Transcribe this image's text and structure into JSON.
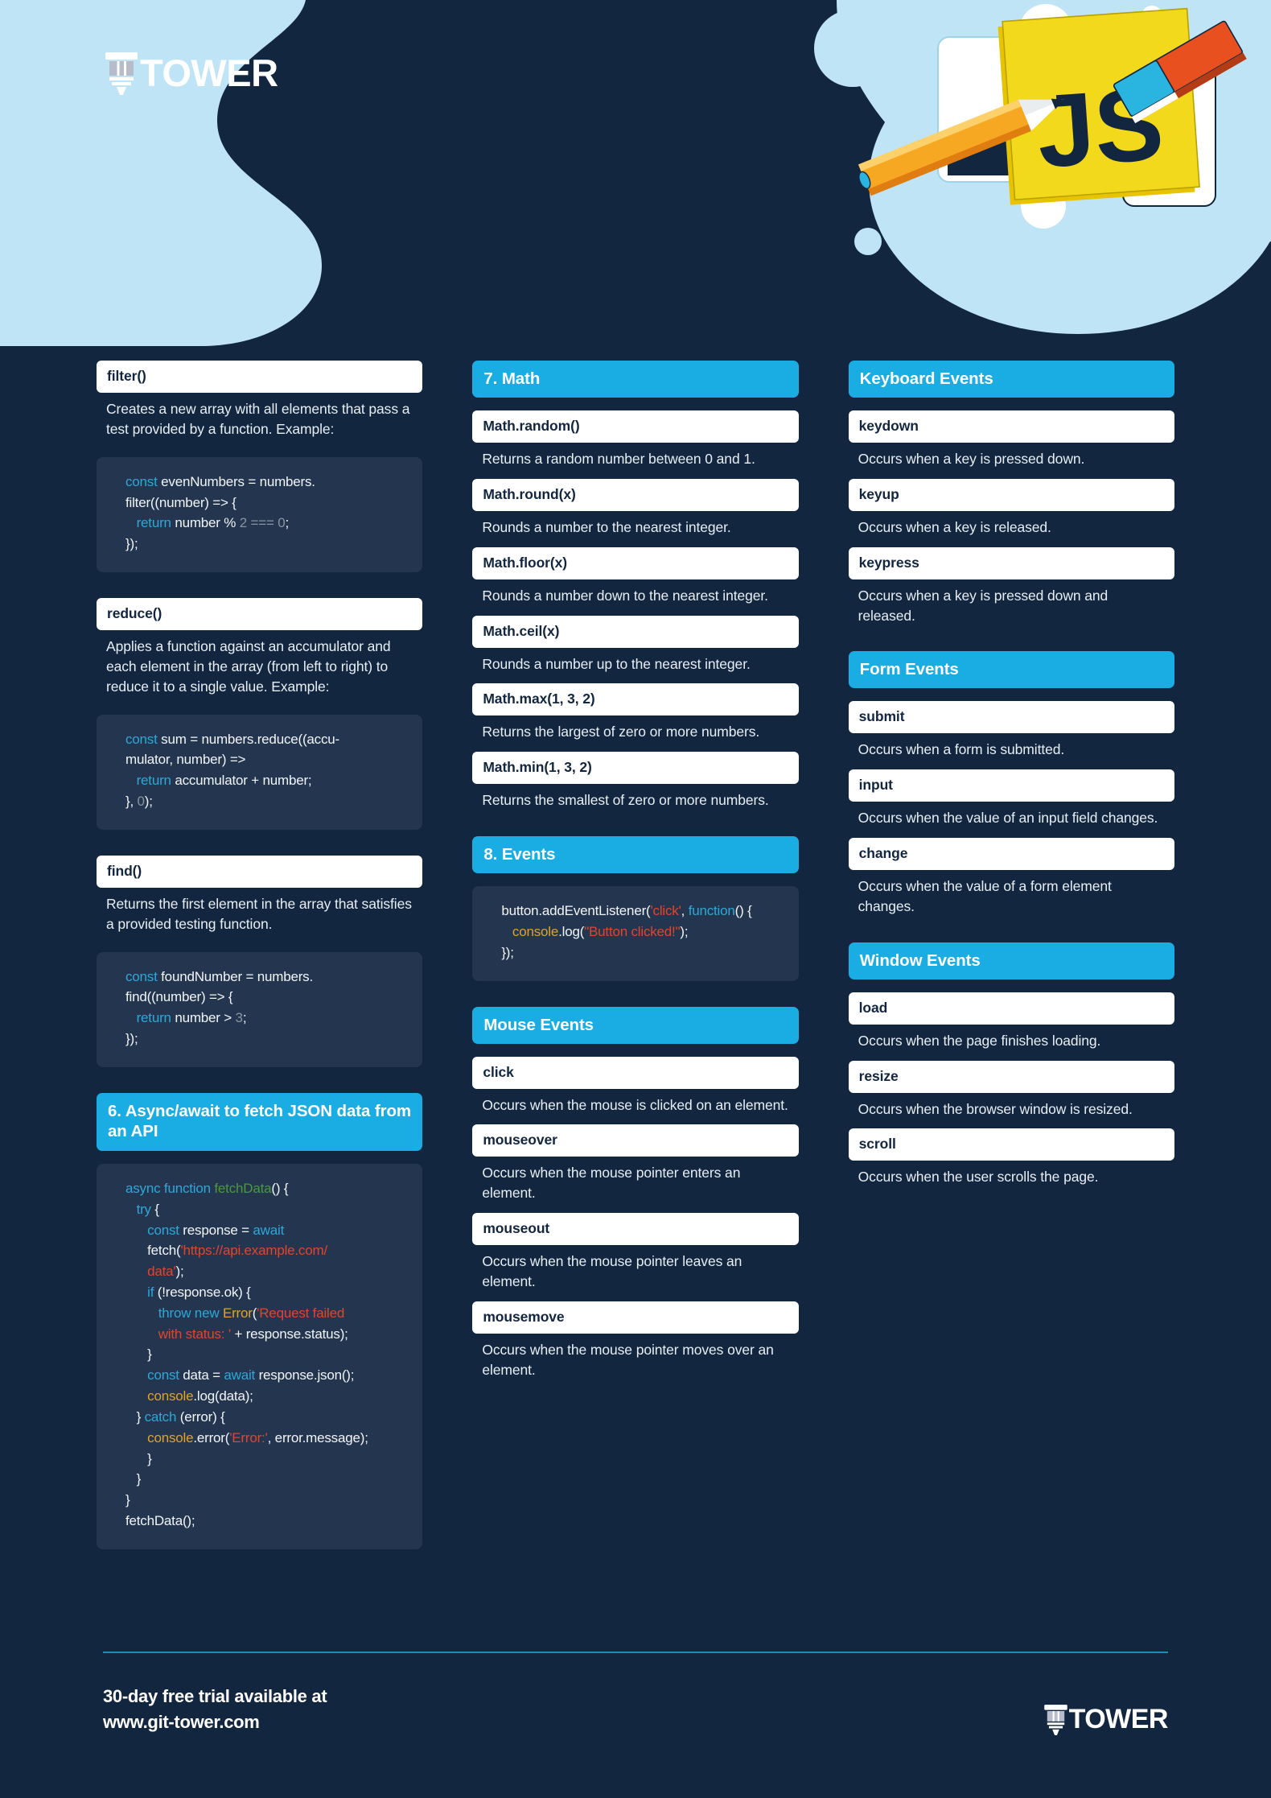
{
  "brand": {
    "name": "TOWER",
    "logo_icon": "tower-logo-icon",
    "js_badge": "JS"
  },
  "footer": {
    "line1": "30-day free trial available at",
    "line2": "www.git-tower.com",
    "name": "TOWER"
  },
  "colors": {
    "background": "#12263f",
    "accent": "#19ade3",
    "card": "#ffffff",
    "code_bg": "#24354f",
    "js_yellow": "#f2d91c",
    "pale_blue": "#bfe4f5"
  },
  "col1": {
    "filter": {
      "term": "filter()",
      "desc": "Creates a new array with all elements that pass a test provided by a function. Example:",
      "code": [
        {
          "t": "const",
          "c": "kw"
        },
        {
          "t": " evenNumbers = numbers.\nfilter((number) => {\n   ",
          "c": "pl"
        },
        {
          "t": "return",
          "c": "kw"
        },
        {
          "t": " number % ",
          "c": "pl"
        },
        {
          "t": "2",
          "c": "num"
        },
        {
          "t": " === ",
          "c": "num"
        },
        {
          "t": "0",
          "c": "num"
        },
        {
          "t": ";\n});",
          "c": "pl"
        }
      ]
    },
    "reduce": {
      "term": "reduce()",
      "desc": "Applies a function against an accumulator and each element in the array (from left to right) to reduce it to a single value. Example:",
      "code": [
        {
          "t": "const",
          "c": "kw"
        },
        {
          "t": " sum = numbers.reduce((accu-\nmulator, number) =>\n   ",
          "c": "pl"
        },
        {
          "t": "return",
          "c": "kw"
        },
        {
          "t": " accumulator + number;\n}, ",
          "c": "pl"
        },
        {
          "t": "0",
          "c": "num"
        },
        {
          "t": ");",
          "c": "pl"
        }
      ]
    },
    "find": {
      "term": "find()",
      "desc": "Returns the first element in the array that satisfies a provided testing function.",
      "code": [
        {
          "t": "const",
          "c": "kw"
        },
        {
          "t": " foundNumber = numbers.\nfind((number) => {\n   ",
          "c": "pl"
        },
        {
          "t": "return",
          "c": "kw"
        },
        {
          "t": " number > ",
          "c": "pl"
        },
        {
          "t": "3",
          "c": "num"
        },
        {
          "t": ";\n});",
          "c": "pl"
        }
      ]
    },
    "async_section": {
      "heading": "6. Async/await to fetch JSON data from an API",
      "code": [
        {
          "t": "async function",
          "c": "kw"
        },
        {
          "t": " ",
          "c": "pl"
        },
        {
          "t": "fetchData",
          "c": "fn"
        },
        {
          "t": "() {\n   ",
          "c": "pl"
        },
        {
          "t": "try",
          "c": "kw"
        },
        {
          "t": " {\n      ",
          "c": "pl"
        },
        {
          "t": "const",
          "c": "kw"
        },
        {
          "t": " response = ",
          "c": "pl"
        },
        {
          "t": "await",
          "c": "kw"
        },
        {
          "t": "\n      fetch(",
          "c": "pl"
        },
        {
          "t": "'https://api.example.com/\n      data'",
          "c": "str"
        },
        {
          "t": ");\n      ",
          "c": "pl"
        },
        {
          "t": "if",
          "c": "kw"
        },
        {
          "t": " (!response.ok) {\n         ",
          "c": "pl"
        },
        {
          "t": "throw new",
          "c": "kw"
        },
        {
          "t": " ",
          "c": "pl"
        },
        {
          "t": "Error",
          "c": "obj"
        },
        {
          "t": "(",
          "c": "pl"
        },
        {
          "t": "'Request failed\n         with status: '",
          "c": "str"
        },
        {
          "t": " + response.status);\n      }\n      ",
          "c": "pl"
        },
        {
          "t": "const",
          "c": "kw"
        },
        {
          "t": " data = ",
          "c": "pl"
        },
        {
          "t": "await",
          "c": "kw"
        },
        {
          "t": " response.json();\n      ",
          "c": "pl"
        },
        {
          "t": "console",
          "c": "obj"
        },
        {
          "t": ".log(data);\n   } ",
          "c": "pl"
        },
        {
          "t": "catch",
          "c": "kw"
        },
        {
          "t": " (error) {\n      ",
          "c": "pl"
        },
        {
          "t": "console",
          "c": "obj"
        },
        {
          "t": ".error(",
          "c": "pl"
        },
        {
          "t": "'Error:'",
          "c": "str"
        },
        {
          "t": ", error.message);\n      }\n   }\n}\nfetchData();",
          "c": "pl"
        }
      ]
    }
  },
  "col2": {
    "math_heading": "7. Math",
    "math_items": [
      {
        "term": "Math.random()",
        "desc": "Returns a random number between 0 and 1."
      },
      {
        "term": "Math.round(x)",
        "desc": "Rounds a number to the nearest integer."
      },
      {
        "term": "Math.floor(x)",
        "desc": "Rounds a number down to the nearest integer."
      },
      {
        "term": "Math.ceil(x)",
        "desc": "Rounds a number up to the nearest integer."
      },
      {
        "term": "Math.max(1, 3, 2)",
        "desc": "Returns the largest of zero or more numbers."
      },
      {
        "term": "Math.min(1, 3, 2)",
        "desc": "Returns the smallest of zero or more numbers."
      }
    ],
    "events_heading": "8. Events",
    "events_code": [
      {
        "t": "button.addEventListener(",
        "c": "pl"
      },
      {
        "t": "'click'",
        "c": "str"
      },
      {
        "t": ", ",
        "c": "pl"
      },
      {
        "t": "function",
        "c": "kw"
      },
      {
        "t": "() {\n   ",
        "c": "pl"
      },
      {
        "t": "console",
        "c": "obj"
      },
      {
        "t": ".log(",
        "c": "pl"
      },
      {
        "t": "\"Button clicked!\"",
        "c": "str"
      },
      {
        "t": ");\n});",
        "c": "pl"
      }
    ],
    "mouse_heading": "Mouse Events",
    "mouse_items": [
      {
        "term": "click",
        "desc": "Occurs when the mouse is clicked on an element."
      },
      {
        "term": "mouseover",
        "desc": "Occurs when the mouse pointer enters an element."
      },
      {
        "term": "mouseout",
        "desc": "Occurs when the mouse pointer leaves an element."
      },
      {
        "term": "mousemove",
        "desc": "Occurs when the mouse pointer moves over an element."
      }
    ]
  },
  "col3": {
    "keyboard_heading": "Keyboard Events",
    "keyboard_items": [
      {
        "term": "keydown",
        "desc": "Occurs when a key is pressed down."
      },
      {
        "term": "keyup",
        "desc": "Occurs when a key is released."
      },
      {
        "term": "keypress",
        "desc": "Occurs when a key is pressed down and released."
      }
    ],
    "form_heading": "Form Events",
    "form_items": [
      {
        "term": "submit",
        "desc": "Occurs when a form is submitted."
      },
      {
        "term": "input",
        "desc": "Occurs when the value of an input field changes."
      },
      {
        "term": "change",
        "desc": "Occurs when the value of a form element changes."
      }
    ],
    "window_heading": "Window Events",
    "window_items": [
      {
        "term": "load",
        "desc": "Occurs when the page finishes loading."
      },
      {
        "term": "resize",
        "desc": "Occurs when the browser window is resized."
      },
      {
        "term": "scroll",
        "desc": "Occurs when the user scrolls the page."
      }
    ]
  }
}
